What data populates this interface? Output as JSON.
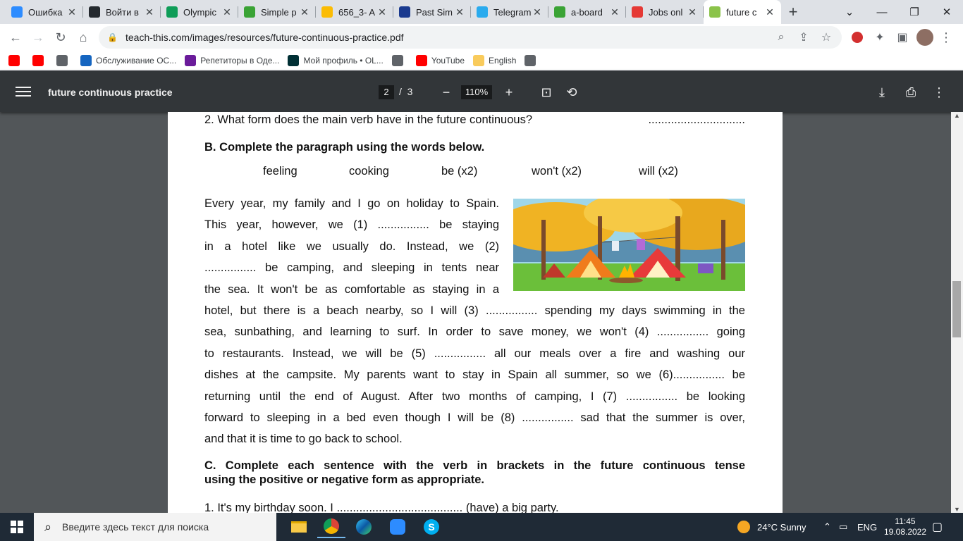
{
  "tabs": [
    {
      "title": "Ошибка",
      "icon": "zoom-icon",
      "color": "#2d8cff"
    },
    {
      "title": "Войти в",
      "icon": "github-icon",
      "color": "#24292e"
    },
    {
      "title": "Olympic",
      "icon": "green-g-icon",
      "color": "#0f9d58"
    },
    {
      "title": "Simple p",
      "icon": "isl-icon",
      "color": "#3aa335"
    },
    {
      "title": "656_3- A",
      "icon": "google-drive-icon",
      "color": "#fbbc04"
    },
    {
      "title": "Past Sim",
      "icon": "eau-icon",
      "color": "#1a3a8f"
    },
    {
      "title": "Telegram",
      "icon": "telegram-icon",
      "color": "#2aabee"
    },
    {
      "title": "a-board",
      "icon": "isl-icon",
      "color": "#3aa335"
    },
    {
      "title": "Jobs onl",
      "icon": "jobs-icon",
      "color": "#e53935"
    },
    {
      "title": "future c",
      "icon": "book-icon",
      "color": "#8bc34a"
    }
  ],
  "address": {
    "url": "teach-this.com/images/resources/future-continuous-practice.pdf"
  },
  "bookmarks": [
    {
      "label": "",
      "icon": "youtube-icon",
      "color": "#ff0000"
    },
    {
      "label": "",
      "icon": "youtube-icon",
      "color": "#ff0000"
    },
    {
      "label": "",
      "icon": "globe-icon",
      "color": "#5f6368"
    },
    {
      "label": "Обслуживание ОС...",
      "icon": "bird-icon",
      "color": "#1565c0"
    },
    {
      "label": "Репетиторы в Оде...",
      "icon": "pattern-icon",
      "color": "#6a1b9a"
    },
    {
      "label": "Мой профиль • OL...",
      "icon": "olx-icon",
      "color": "#002f34"
    },
    {
      "label": "",
      "icon": "globe-icon",
      "color": "#5f6368"
    },
    {
      "label": "YouTube",
      "icon": "youtube-icon",
      "color": "#ff0000"
    },
    {
      "label": "English",
      "icon": "folder-icon",
      "color": "#f9cb5c"
    },
    {
      "label": "",
      "icon": "globe-icon",
      "color": "#5f6368"
    }
  ],
  "pdf": {
    "title": "future continuous practice",
    "page_current": "2",
    "page_total": "3",
    "zoom": "110%"
  },
  "doc": {
    "q2": "2. What form does the main verb have in the future continuous?",
    "q2_dots": "..............................",
    "sectionB": "B. Complete the paragraph using the words below.",
    "words": [
      "feeling",
      "cooking",
      "be (x2)",
      "won't (x2)",
      "will (x2)"
    ],
    "para_lines": [
      "Every year, my family and I go on holiday to  Spain.",
      "This year, however, we (1) ................ be staying",
      "in a hotel like we usually do. Instead, we (2)",
      "................ be camping, and sleeping in tents near",
      "the sea. It won't be as comfortable as staying in a",
      "hotel, but there is a beach nearby, so I will (3) ................ spending my days swimming in the",
      "sea, sunbathing, and learning to surf. In order to save money, we won't (4) ................ going",
      "to restaurants. Instead, we will be (5) ................ all our meals over a fire and washing our",
      "dishes at the campsite. My parents want to stay in Spain all summer, so we (6)................ be",
      "returning until the end of August. After two months of camping, I (7) ................ be looking",
      "forward to sleeping in a bed even though I will be (8) ................ sad that the summer is over,",
      "and that it is time to go back to school."
    ],
    "sectionC_1": "C. Complete each sentence with the verb in brackets in the future continuous tense",
    "sectionC_2": "using the positive or negative form as appropriate.",
    "c1": "1. It's my birthday soon. I ....................................... (have) a big party."
  },
  "taskbar": {
    "search_placeholder": "Введите здесь текст для поиска",
    "weather": "24°C  Sunny",
    "lang": "ENG",
    "time": "11:45",
    "date": "19.08.2022"
  }
}
